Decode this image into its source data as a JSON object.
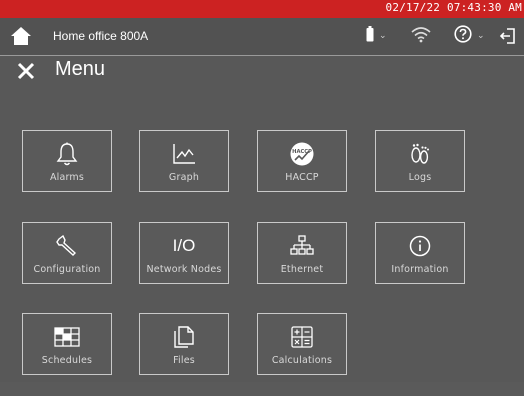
{
  "status": {
    "datetime": "02/17/22 07:43:30 AM"
  },
  "header": {
    "site_name": "Home office 800A"
  },
  "menu": {
    "title": "Menu"
  },
  "tiles": [
    {
      "label": "Alarms",
      "icon": "bell-icon"
    },
    {
      "label": "Graph",
      "icon": "graph-icon"
    },
    {
      "label": "HACCP",
      "icon": "haccp-icon",
      "icon_text": "HACCP"
    },
    {
      "label": "Logs",
      "icon": "footprints-icon"
    },
    {
      "label": "Configuration",
      "icon": "wrench-icon"
    },
    {
      "label": "Network Nodes",
      "icon": "io-icon",
      "icon_text": "I/O"
    },
    {
      "label": "Ethernet",
      "icon": "network-icon"
    },
    {
      "label": "Information",
      "icon": "info-icon"
    },
    {
      "label": "Schedules",
      "icon": "schedule-grid-icon"
    },
    {
      "label": "Files",
      "icon": "files-icon"
    },
    {
      "label": "Calculations",
      "icon": "calculator-icon"
    }
  ],
  "colors": {
    "status_bar": "#cc2222",
    "background": "#585858",
    "tile_border": "#c9c9c9"
  }
}
